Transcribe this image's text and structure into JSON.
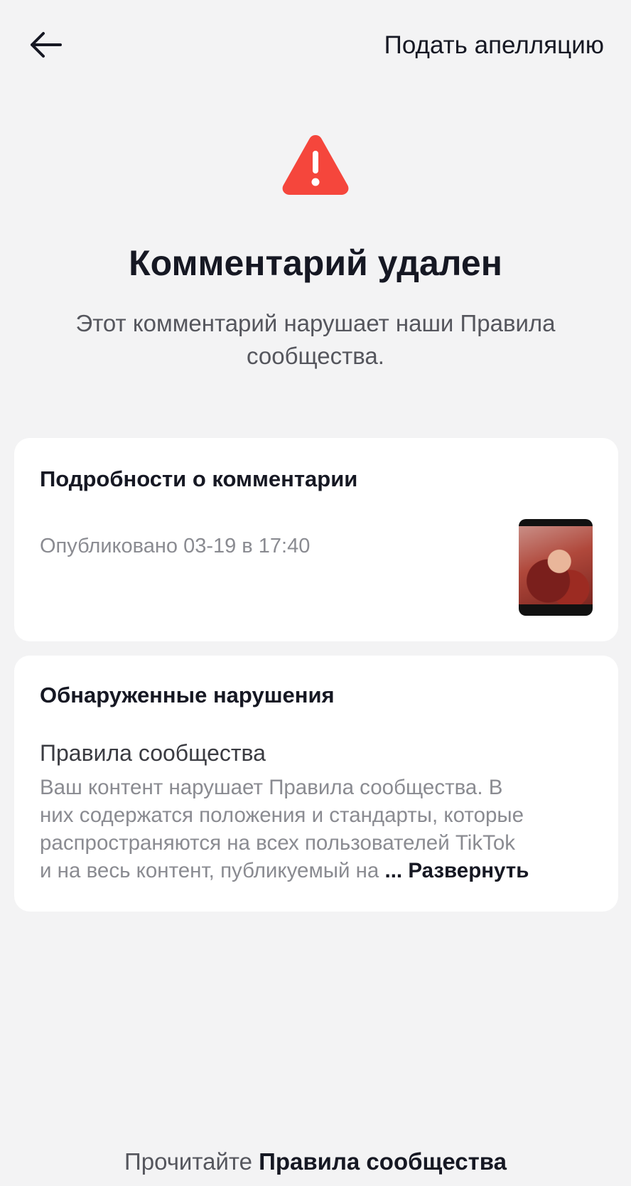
{
  "header": {
    "back_icon": "arrow-left-icon",
    "appeal_label": "Подать апелляцию"
  },
  "status": {
    "icon": "warning-triangle-icon",
    "icon_color": "#f5463c",
    "title": "Комментарий удален",
    "description": "Этот комментарий нарушает наши Правила сообщества."
  },
  "details": {
    "title": "Подробности о комментарии",
    "published": "Опубликовано 03-19 в 17:40"
  },
  "violations": {
    "title": "Обнаруженные нарушения",
    "rule_name": "Правила сообщества",
    "desc_lines": [
      "Ваш контент нарушает Правила сообщества. В",
      "них содержатся положения и стандарты, которые",
      "распространяются на всех пользователей TikTok",
      "и на весь контент, публикуемый на"
    ],
    "ellipsis": "...",
    "expand_label": "Развернуть"
  },
  "footer": {
    "prefix": "Прочитайте",
    "link": "Правила сообщества"
  }
}
